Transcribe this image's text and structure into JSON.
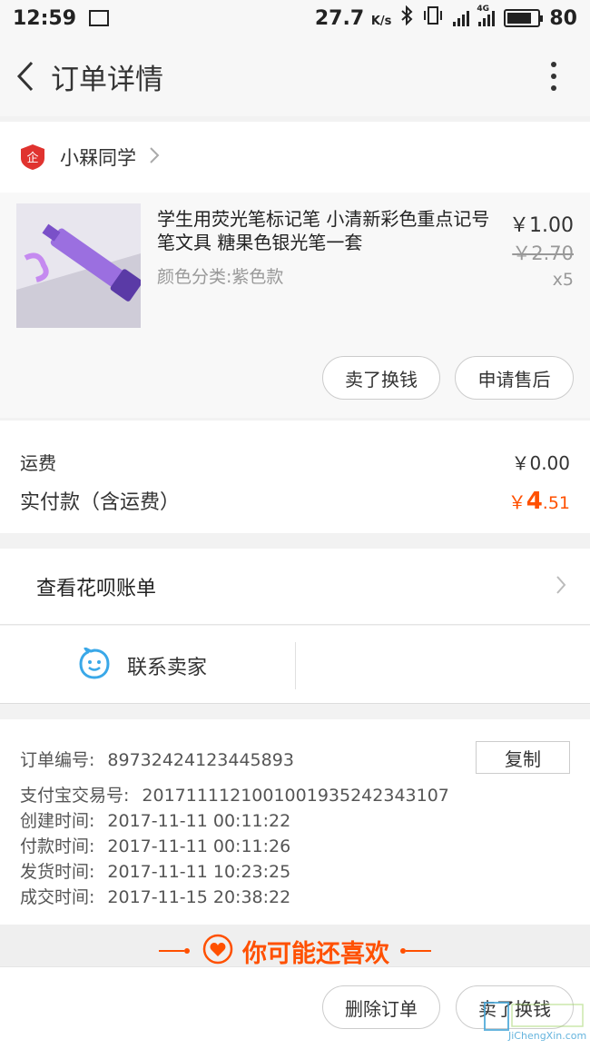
{
  "status_bar": {
    "time": "12:59",
    "speed": "27.7",
    "speed_unit": "K/s",
    "network": "4G",
    "battery": "80"
  },
  "nav": {
    "title": "订单详情"
  },
  "shop": {
    "name": "小槑同学",
    "logo_char": "企"
  },
  "product": {
    "title": "学生用荧光笔标记笔 小清新彩色重点记号笔文具 糖果色银光笔一套",
    "sku": "颜色分类:紫色款",
    "price": "￥1.00",
    "original_price": "￥2.70",
    "quantity": "x5",
    "buttons": {
      "sell": "卖了换钱",
      "after_sale": "申请售后"
    }
  },
  "cost": {
    "shipping_label": "运费",
    "shipping_value": "￥0.00",
    "paid_label": "实付款（含运费）",
    "paid_symbol": "￥",
    "paid_int": "4",
    "paid_dec": ".51"
  },
  "huabei": {
    "label": "查看花呗账单"
  },
  "contact": {
    "label": "联系卖家"
  },
  "order_info": {
    "copy_label": "复制",
    "lines": [
      {
        "label": "订单编号:",
        "value": "89732424123445893"
      },
      {
        "label": "支付宝交易号:",
        "value": "2017111121001001935242343107"
      },
      {
        "label": "创建时间:",
        "value": "2017-11-11 00:11:22"
      },
      {
        "label": "付款时间:",
        "value": "2017-11-11 00:11:26"
      },
      {
        "label": "发货时间:",
        "value": "2017-11-11 10:23:25"
      },
      {
        "label": "成交时间:",
        "value": "2017-11-15 20:38:22"
      }
    ]
  },
  "recommend": {
    "title": "你可能还喜欢"
  },
  "bottom": {
    "delete": "删除订单",
    "sell": "卖了换钱"
  },
  "watermark": {
    "url": "JiChengXin.com"
  },
  "colors": {
    "accent": "#ff5000",
    "contact_icon": "#3aa8e8",
    "shop_logo": "#e0332f"
  }
}
